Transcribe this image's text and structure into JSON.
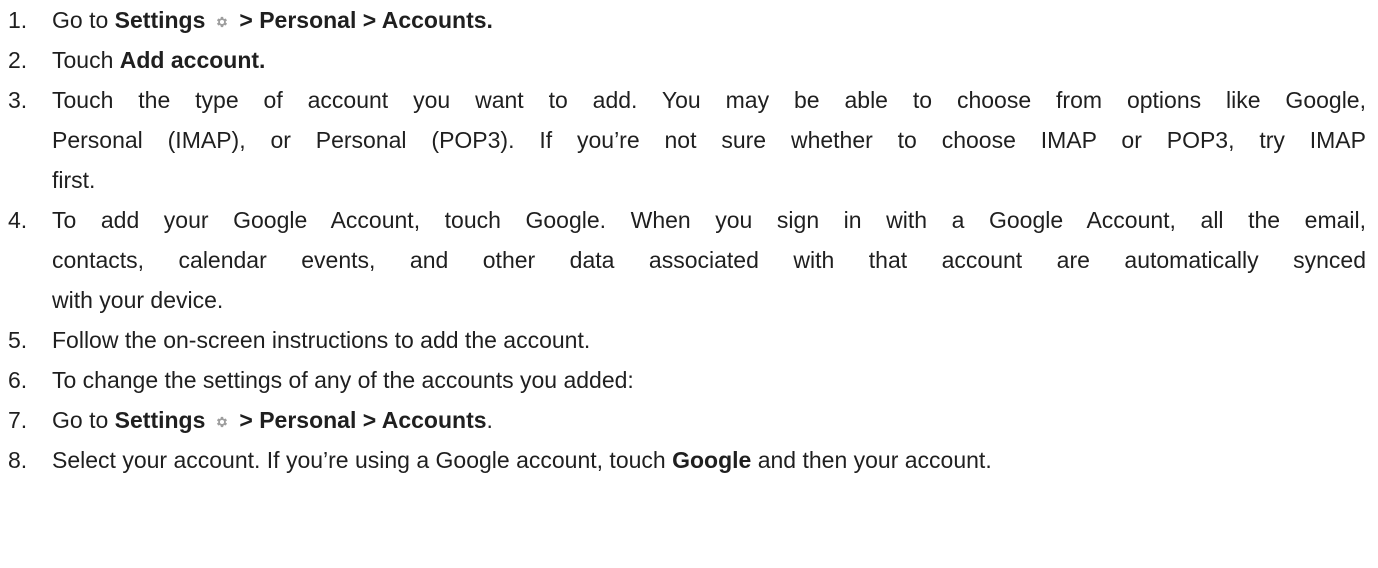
{
  "steps": [
    {
      "number": "1.",
      "pre": "Go to ",
      "settings": "Settings",
      "gear_icon": "gear-icon",
      "path": "> Personal > Accounts."
    },
    {
      "number": "2.",
      "pre": "Touch ",
      "bold": "Add account."
    },
    {
      "number": "3.",
      "lines": [
        "Touch the type of account you want to add. You may be able to choose from options like Google,",
        "Personal (IMAP), or Personal (POP3). If you’re not sure whether to choose IMAP or POP3, try IMAP",
        "first."
      ]
    },
    {
      "number": "4.",
      "lines": [
        "To add your Google Account, touch Google. When you sign in with a Google Account, all the email,",
        "contacts, calendar events, and other data associated with that account are automatically synced",
        "with your device."
      ]
    },
    {
      "number": "5.",
      "text": "Follow the on-screen instructions to add the account."
    },
    {
      "number": "6.",
      "text": "To change the settings of any of the accounts you added:"
    },
    {
      "number": "7.",
      "pre": "Go to ",
      "settings": "Settings",
      "gear_icon": "gear-icon",
      "path": "> Personal > Accounts",
      "post": "."
    },
    {
      "number": "8.",
      "pre": "Select your account. If you’re using a Google account, touch ",
      "bold": "Google",
      "post": " and then your account."
    }
  ],
  "colors": {
    "text": "#1f1f1f",
    "icon": "#9e9e9e"
  }
}
